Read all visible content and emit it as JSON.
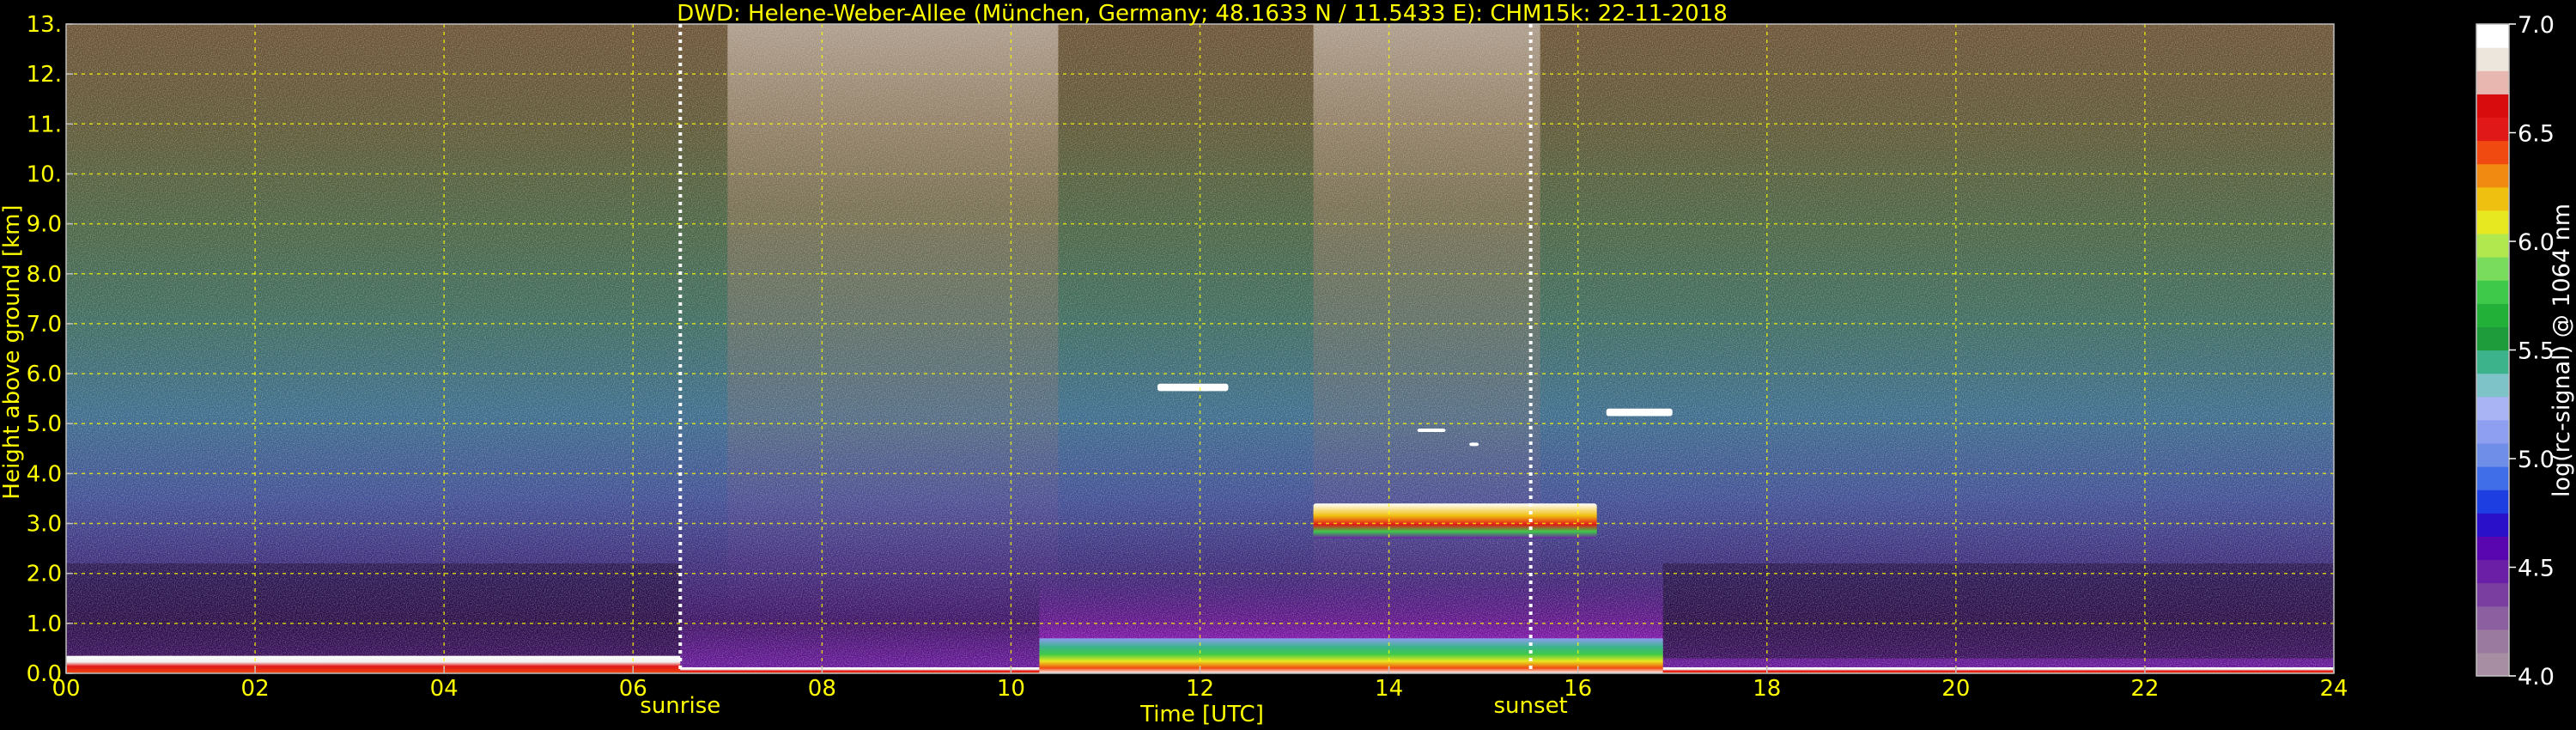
{
  "chart_data": {
    "type": "heatmap",
    "title": "DWD: Helene-Weber-Allee (München, Germany; 48.1633 N / 11.5433 E):    CHM15k: 22-11-2018",
    "xlabel": "Time [UTC]",
    "ylabel": "Height above ground [km]",
    "xlim": [
      0,
      24
    ],
    "ylim": [
      0,
      13
    ],
    "x_ticks": [
      "00",
      "02",
      "04",
      "06",
      "08",
      "10",
      "12",
      "14",
      "16",
      "18",
      "20",
      "22",
      "24"
    ],
    "y_ticks": [
      "0.0",
      "1.0",
      "2.0",
      "3.0",
      "4.0",
      "5.0",
      "6.0",
      "7.0",
      "8.0",
      "9.0",
      "10.",
      "11.",
      "12.",
      "13."
    ],
    "grid": true,
    "markers": [
      {
        "label": "sunrise",
        "x": 6.5
      },
      {
        "label": "sunset",
        "x": 15.5
      }
    ],
    "colorbar": {
      "label": "log(rc-signal) @ 1064 nm",
      "range": [
        4.0,
        7.0
      ],
      "ticks": [
        "4.0",
        "4.5",
        "5.0",
        "5.5",
        "6.0",
        "6.5",
        "7.0"
      ],
      "colors": [
        "#a78ea3",
        "#9b7aa0",
        "#8b5fa0",
        "#7a3ea0",
        "#6a1fa6",
        "#5a06b0",
        "#2a10c8",
        "#1d3ee0",
        "#3f6ee8",
        "#6f8ee8",
        "#8e9ef0",
        "#a8b4f4",
        "#7ec3c8",
        "#3cb38a",
        "#1e9b3b",
        "#23b038",
        "#3ec94a",
        "#7adc5c",
        "#b0e84e",
        "#e8e820",
        "#f0c010",
        "#f08a10",
        "#f04a10",
        "#e01818",
        "#d80c0c",
        "#e8b8b0",
        "#ece6dc",
        "#ffffff"
      ]
    },
    "clouds": [
      {
        "x_start": 11.55,
        "x_end": 12.3,
        "y_bottom": 5.65,
        "y_top": 5.8
      },
      {
        "x_start": 14.3,
        "x_end": 14.6,
        "y_bottom": 4.85,
        "y_top": 4.9
      },
      {
        "x_start": 14.85,
        "x_end": 14.95,
        "y_bottom": 4.55,
        "y_top": 4.62
      },
      {
        "x_start": 16.3,
        "x_end": 17.0,
        "y_bottom": 5.15,
        "y_top": 5.3
      },
      {
        "x_start": 13.2,
        "x_end": 16.2,
        "y_bottom": 2.7,
        "y_top": 3.4
      }
    ],
    "boundary_layer": [
      {
        "x_start": 0.0,
        "x_end": 6.5,
        "y_top": 0.35
      },
      {
        "x_start": 6.5,
        "x_end": 10.3,
        "y_top": 0.12
      },
      {
        "x_start": 10.3,
        "x_end": 16.9,
        "y_top": 0.7
      },
      {
        "x_start": 16.9,
        "x_end": 24.0,
        "y_top": 0.12
      }
    ]
  }
}
